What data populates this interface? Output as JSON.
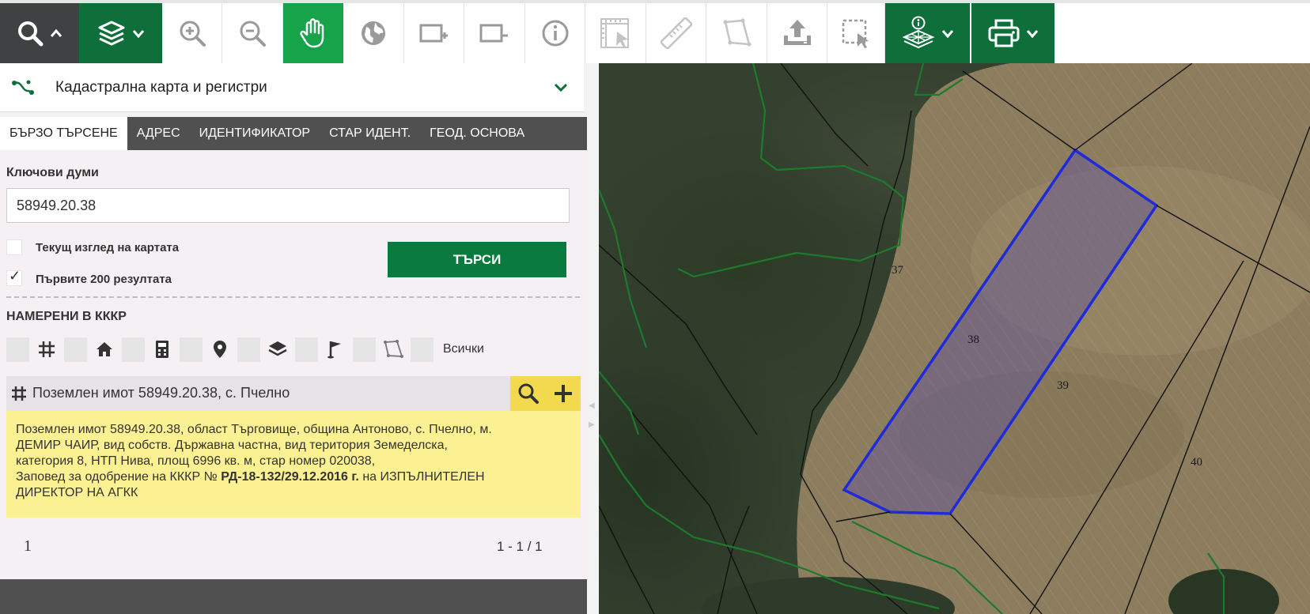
{
  "toolbar": {
    "buttons": [
      {
        "icon": "search-icon",
        "has_caret": true,
        "caret_icon": "chevron-up-icon"
      },
      {
        "icon": "layers-icon",
        "has_caret": true,
        "caret_icon": "chevron-down-icon"
      },
      {
        "icon": "zoom-in-icon"
      },
      {
        "icon": "zoom-out-icon"
      },
      {
        "icon": "pan-hand-icon",
        "active": true
      },
      {
        "icon": "globe-icon"
      },
      {
        "icon": "add-rectangle-icon"
      },
      {
        "icon": "remove-rectangle-icon"
      },
      {
        "icon": "info-icon"
      },
      {
        "icon": "measure-scale-icon"
      },
      {
        "icon": "ruler-icon"
      },
      {
        "icon": "polygon-icon"
      },
      {
        "icon": "upload-icon"
      },
      {
        "icon": "select-area-icon"
      },
      {
        "icon": "layer-info-icon",
        "has_caret": true,
        "caret_icon": "chevron-down-icon"
      },
      {
        "icon": "printer-icon",
        "has_caret": true,
        "caret_icon": "chevron-down-icon"
      }
    ],
    "colors": {
      "dark": "#3f4142",
      "green": "#0e6f3a",
      "active": "#16a34a"
    }
  },
  "panel": {
    "title": "Кадастрална карта и регистри",
    "tabs": [
      "БЪРЗО ТЪРСЕНЕ",
      "АДРЕС",
      "ИДЕНТИФИКАТОР",
      "СТАР ИДЕНТ.",
      "ГЕОД. ОСНОВА"
    ],
    "active_tab": 0,
    "keywords_label": "Ключови думи",
    "keywords_value": "58949.20.38",
    "checkbox_current_view": {
      "label": "Текущ изглед на картата",
      "checked": false
    },
    "checkbox_first_200": {
      "label": "Първите 200 резултата",
      "checked": true
    },
    "search_button": "ТЪРСИ",
    "found_label": "НАМЕРЕНИ В КККР",
    "filter_icons": [
      "grid-icon",
      "home-icon",
      "calculator-icon",
      "location-pin-icon",
      "layers-icon",
      "flag-icon",
      "polygon-icon"
    ],
    "filter_all_label": "Всички",
    "result": {
      "title": "Поземлен имот 58949.20.38, с. Пчелно",
      "info_line1": "Поземлен имот 58949.20.38, област Търговище, община Антоново, с. Пчелно, м.",
      "info_line2": "ДЕМИР ЧАИР, вид собств. Държавна частна, вид територия Земеделска,",
      "info_line3": "категория 8, НТП Нива, площ 6996 кв. м, стар номер 020038,",
      "info_line4_pre": "Заповед за одобрение на КККР № ",
      "info_line4_bold": "РД-18-132/29.12.2016 г.",
      "info_line4_post": " на ИЗПЪЛНИТЕЛЕН",
      "info_line5": "ДИРЕКТОР НА АГКК"
    },
    "pagination": {
      "page": "1",
      "range": "1 - 1 / 1"
    }
  },
  "map": {
    "parcel_labels": [
      "37",
      "38",
      "39",
      "40"
    ],
    "selected_parcel": "38",
    "selection_color": "#1f2bd6",
    "boundary_color": "#111111",
    "forest_border_color": "#1d7a2c"
  }
}
